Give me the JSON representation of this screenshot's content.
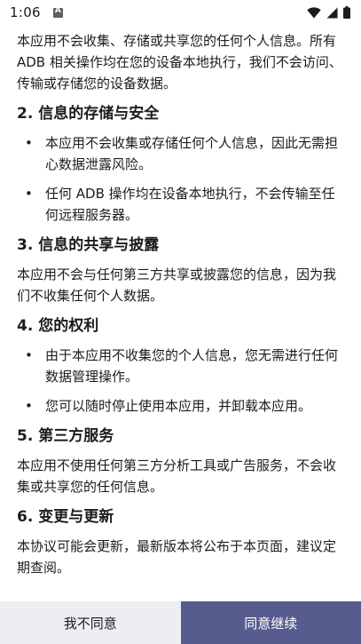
{
  "status_bar": {
    "time": "1:06",
    "notification_icon": "a-badge-icon",
    "icons": [
      "wifi-icon",
      "cellular-signal-icon",
      "battery-icon"
    ]
  },
  "content": {
    "intro": "本应用不会收集、存储或共享您的任何个人信息。所有 ADB 相关操作均在您的设备本地执行，我们不会访问、传输或存储您的设备数据。",
    "section2": {
      "heading": "2. 信息的存储与安全",
      "bullets": [
        "本应用不会收集或存储任何个人信息，因此无需担心数据泄露风险。",
        "任何 ADB 操作均在设备本地执行，不会传输至任何远程服务器。"
      ]
    },
    "section3": {
      "heading": "3. 信息的共享与披露",
      "text": "本应用不会与任何第三方共享或披露您的信息，因为我们不收集任何个人数据。"
    },
    "section4": {
      "heading": "4. 您的权利",
      "bullets": [
        "由于本应用不收集您的个人信息，您无需进行任何数据管理操作。",
        "您可以随时停止使用本应用，并卸载本应用。"
      ]
    },
    "section5": {
      "heading": "5. 第三方服务",
      "text": "本应用不使用任何第三方分析工具或广告服务，不会收集或共享您的任何信息。"
    },
    "section6": {
      "heading": "6. 变更与更新",
      "text": "本协议可能会更新，最新版本将公布于本页面，建议定期查阅。"
    }
  },
  "buttons": {
    "disagree": "我不同意",
    "agree": "同意继续"
  },
  "colors": {
    "agree_button_bg": "#575c8f",
    "disagree_button_bg": "#eceef1",
    "text": "#1c1b1f"
  }
}
